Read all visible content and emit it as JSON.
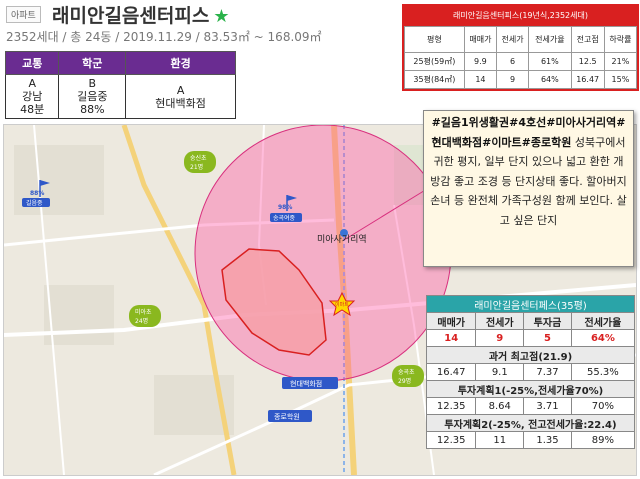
{
  "header": {
    "type_badge": "아파트",
    "title": "래미안길음센터피스",
    "subtitle": "2352세대 / 총 24동 / 2019.11.29 / 83.53㎡ ~ 168.09㎡"
  },
  "category_table": {
    "headers": [
      "교통",
      "학군",
      "환경"
    ],
    "cells": [
      {
        "grade": "A",
        "line1": "강남",
        "line2": "48분"
      },
      {
        "grade": "B",
        "line1": "길음중",
        "line2": "88%"
      },
      {
        "grade": "A",
        "line1": "현대백화점",
        "line2": ""
      }
    ]
  },
  "stats_table": {
    "title": "래미안길음센터피스(19년식,2352세대)",
    "columns": [
      "평형",
      "매매가",
      "전세가",
      "전세가율",
      "전고점",
      "하락률"
    ],
    "rows": [
      [
        "25평(59㎡)",
        "9.9",
        "6",
        "61%",
        "12.5",
        "21%"
      ],
      [
        "35평(84㎡)",
        "14",
        "9",
        "64%",
        "16.47",
        "15%"
      ]
    ]
  },
  "description": {
    "tags": "#길음1위생활권#4호선#미아사거리역#현대백화점#이마트#종로학원",
    "body": "성북구에서 귀한 평지, 일부 단지 있으나 넓고 환한 개방감 좋고 조경 등 단지상태 좋다. 할아버지 손녀 등 완전체 가족구성원 함께 보인다. 살고 싶은 단지"
  },
  "invest_table": {
    "title": "래미안길음센터페스(35평)",
    "header_cols": [
      "매매가",
      "전세가",
      "투자금",
      "전세가율"
    ],
    "main_row": [
      "14",
      "9",
      "5",
      "64%"
    ],
    "section1_title": "과거 최고점(21.9)",
    "section1_row": [
      "16.47",
      "9.1",
      "7.37",
      "55.3%"
    ],
    "section2_title": "투자계획1(-25%,전세가율70%)",
    "section2_row": [
      "12.35",
      "8.64",
      "3.71",
      "70%"
    ],
    "section3_title": "투자계획2(-25%, 전고전세가율:22.4)",
    "section3_row": [
      "12.35",
      "11",
      "1.35",
      "89%"
    ]
  },
  "map": {
    "station_label": "미아사거리역",
    "markers": {
      "gileum_middle": {
        "pct": "88%",
        "name": "길음중"
      },
      "school_middle": {
        "pct": "98%",
        "name": "송곡여중"
      },
      "hyundai": "현대백화점",
      "jongro": "종로학원",
      "emart": "이마트",
      "poi_sungsin": {
        "name": "숭신초",
        "count": "21명"
      },
      "poi_mia": {
        "name": "미아초",
        "count": "24명"
      },
      "poi_soonghwa": {
        "name": "숭곡초",
        "count": "29명"
      }
    }
  },
  "colors": {
    "purple": "#6a2c91",
    "red": "#d92020",
    "teal": "#2aa4a8",
    "circle": "#ff4fa0",
    "area_fill": "#f6a0a8",
    "marker_green": "#8ab81f",
    "marker_blue": "#2f58c8"
  }
}
